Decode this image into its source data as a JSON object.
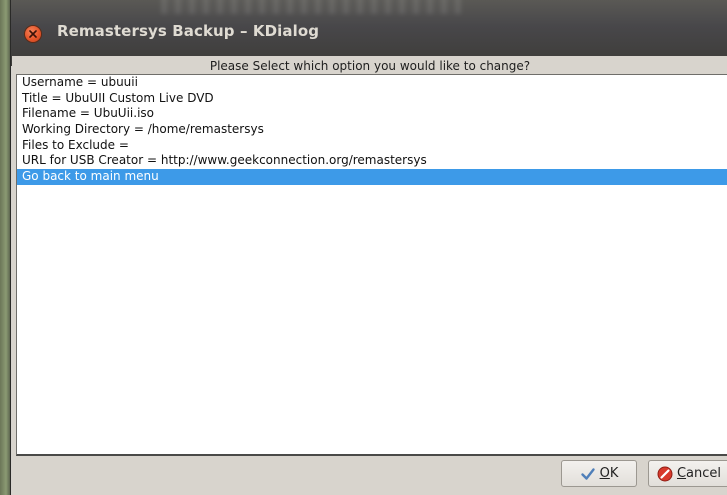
{
  "window": {
    "title": "Remastersys Backup – KDialog"
  },
  "dialog": {
    "prompt": "Please Select which option you would like to change?",
    "items": [
      "Username = ubuuii",
      "Title = UbuUII Custom Live DVD",
      "Filename = UbuUii.iso",
      "Working Directory = /home/remastersys",
      "Files to Exclude =",
      "URL for USB Creator = http://www.geekconnection.org/remastersys",
      "Go back to main menu"
    ],
    "selected_index": 6,
    "ok_label": "OK",
    "cancel_label": "Cancel"
  },
  "icons": {
    "close": "close-icon",
    "ok": "checkmark-icon",
    "cancel": "no-entry-icon"
  },
  "colors": {
    "selection": "#3d9ae8",
    "close_button": "#e5552a",
    "titlebar": "#3d3c38"
  }
}
